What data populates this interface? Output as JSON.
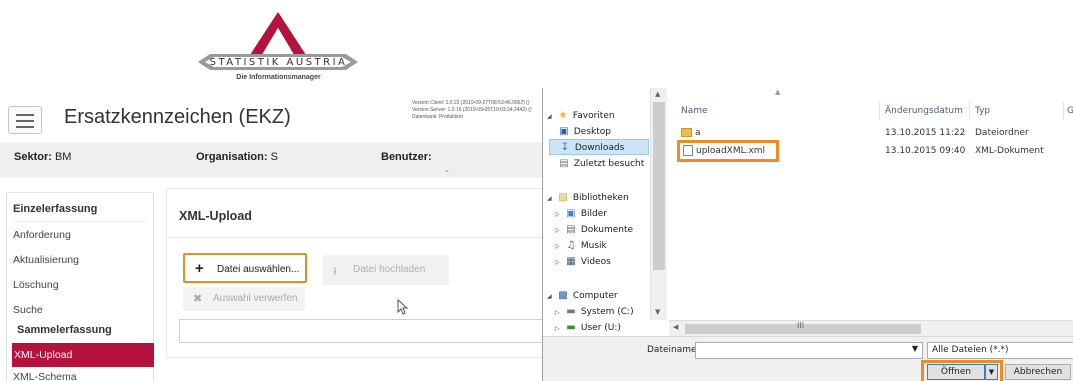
{
  "logo": {
    "name": "STATISTIK AUSTRIA",
    "tagline": "Die Informationsmanager",
    "colors": {
      "red": "#b5133e",
      "gray": "#8a8a8a"
    }
  },
  "app": {
    "title": "Ersatzkennzeichen (EKZ)",
    "version_client": "Version Client: 1.0.22 (2019-09-27T08:53:46.0962) ()",
    "version_server": "Version Server: 1.0.16 (2019-09-05T10:03:34.2442) ()",
    "database": "Datenbank:    Produktion",
    "info": {
      "sektor_label": "Sektor:",
      "sektor_value": "BM",
      "org_label": "Organisation:",
      "org_value": "S",
      "user_label": "Benutzer:"
    },
    "sidebar": {
      "section1": "Einzelerfassung",
      "items": [
        "Anforderung",
        "Aktualisierung",
        "Löschung",
        "Suche"
      ],
      "section2": "Sammelerfassung",
      "active": "XML-Upload",
      "next": "XML-Schema"
    },
    "panel": {
      "title": "XML-Upload",
      "select_button": "Datei auswählen...",
      "upload_button": "Datei hochladen",
      "discard_button": "Auswahl verwerfen"
    },
    "accent": "#b5133e",
    "highlight": "#f08a24"
  },
  "dialog": {
    "nav": {
      "favorites": "Favoriten",
      "desktop": "Desktop",
      "downloads": "Downloads",
      "recent": "Zuletzt besucht",
      "libraries": "Bibliotheken",
      "pictures": "Bilder",
      "documents": "Dokumente",
      "music": "Musik",
      "videos": "Videos",
      "computer": "Computer",
      "system": "System (C:)",
      "user": "User (U:)"
    },
    "columns": {
      "name": "Name",
      "date": "Änderungsdatum",
      "type": "Typ",
      "extra": "G"
    },
    "files": [
      {
        "name": "a",
        "date": "13.10.2015 11:22",
        "type": "Dateiordner"
      },
      {
        "name": "uploadXML.xml",
        "date": "13.10.2015 09:40",
        "type": "XML-Dokument"
      }
    ],
    "filename_label": "Dateiname:",
    "filename_value": "",
    "filter": "Alle Dateien (*.*)",
    "open_button": "Öffnen",
    "cancel_button": "Abbrechen",
    "scroll_grip": "III"
  }
}
